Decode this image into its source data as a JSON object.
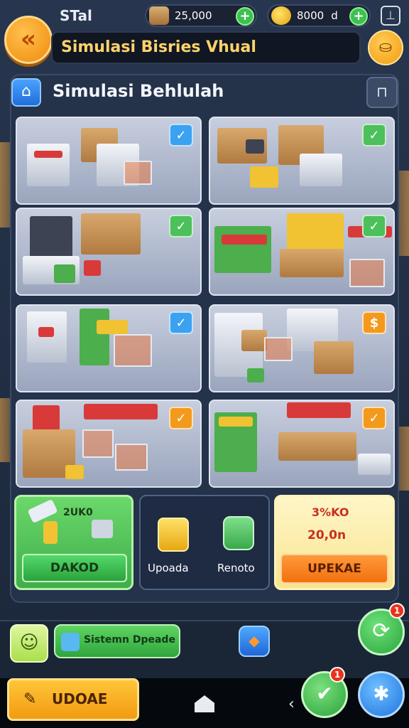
{
  "status": {
    "carrier": "STal",
    "cash": "25,000",
    "gold": "8000",
    "gold_suffix": "d"
  },
  "header": {
    "title": "Simulasi Bisries Vhual"
  },
  "section": {
    "title": "Simulasi Behlulah"
  },
  "tiles": [
    {
      "badge": "✓",
      "badge_color": "blue"
    },
    {
      "badge": "✓",
      "badge_color": "green"
    },
    {
      "badge": "✓",
      "badge_color": "green"
    },
    {
      "badge": "✓",
      "badge_color": "green"
    },
    {
      "badge": "✓",
      "badge_color": "blue"
    },
    {
      "badge": "$",
      "badge_color": "orange"
    },
    {
      "badge": "✓",
      "badge_color": "orange"
    },
    {
      "badge": "✓",
      "badge_color": "orange"
    }
  ],
  "cards": {
    "download": {
      "label": "2UK0",
      "button": "DAKOD"
    },
    "upgrades": {
      "left_label": "Upoada",
      "right_label": "Renoto"
    },
    "upgrade": {
      "line1": "3%KO",
      "line2": "20,0n",
      "button": "UPEKAE"
    }
  },
  "toolbar": {
    "stream_label": "Sistemn Dpeade",
    "refresh_badge": "1",
    "cart_badge": "1"
  },
  "bottom": {
    "update_label": "UDOAE"
  },
  "colors": {
    "accent_orange": "#f29a10",
    "accent_green": "#3fae4a",
    "title_yellow": "#ffd36b"
  }
}
